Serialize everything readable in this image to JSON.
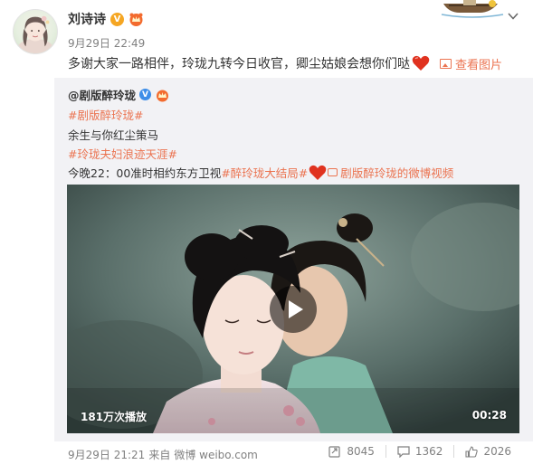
{
  "post": {
    "author": "刘诗诗",
    "date": "9月29日 22:49",
    "text": "多谢大家一路相伴，玲珑九转今日收官，卿尘姑娘会想你们哒",
    "view_pics_label": "查看图片"
  },
  "repost": {
    "author": "@剧版醉玲珑",
    "tag1": "#剧版醉玲珑#",
    "line1": "余生与你红尘策马",
    "tag2": "#玲珑夫妇浪迹天涯#",
    "line2_prefix": "今晚22：00准时相约东方卫视",
    "tag3": "#醉玲珑大结局#",
    "video_link_label": "剧版醉玲珑的微博视频",
    "video": {
      "play_count": "181万次播放",
      "duration": "00:28"
    },
    "footer": {
      "date": "9月29日 21:21",
      "source_prefix": "来自",
      "source": "微博 weibo.com"
    },
    "stats": {
      "reposts": "8045",
      "comments": "1362",
      "likes": "2026"
    }
  },
  "colors": {
    "accent": "#eb7350",
    "verified_gold": "#f5a623",
    "verified_blue": "#3e8ee8",
    "repost_bg": "#f2f2f5"
  },
  "icons": [
    "chevron-down-icon",
    "picture-icon",
    "heart-emoji-icon",
    "video-icon",
    "play-icon",
    "repost-icon",
    "comment-icon",
    "like-icon"
  ]
}
